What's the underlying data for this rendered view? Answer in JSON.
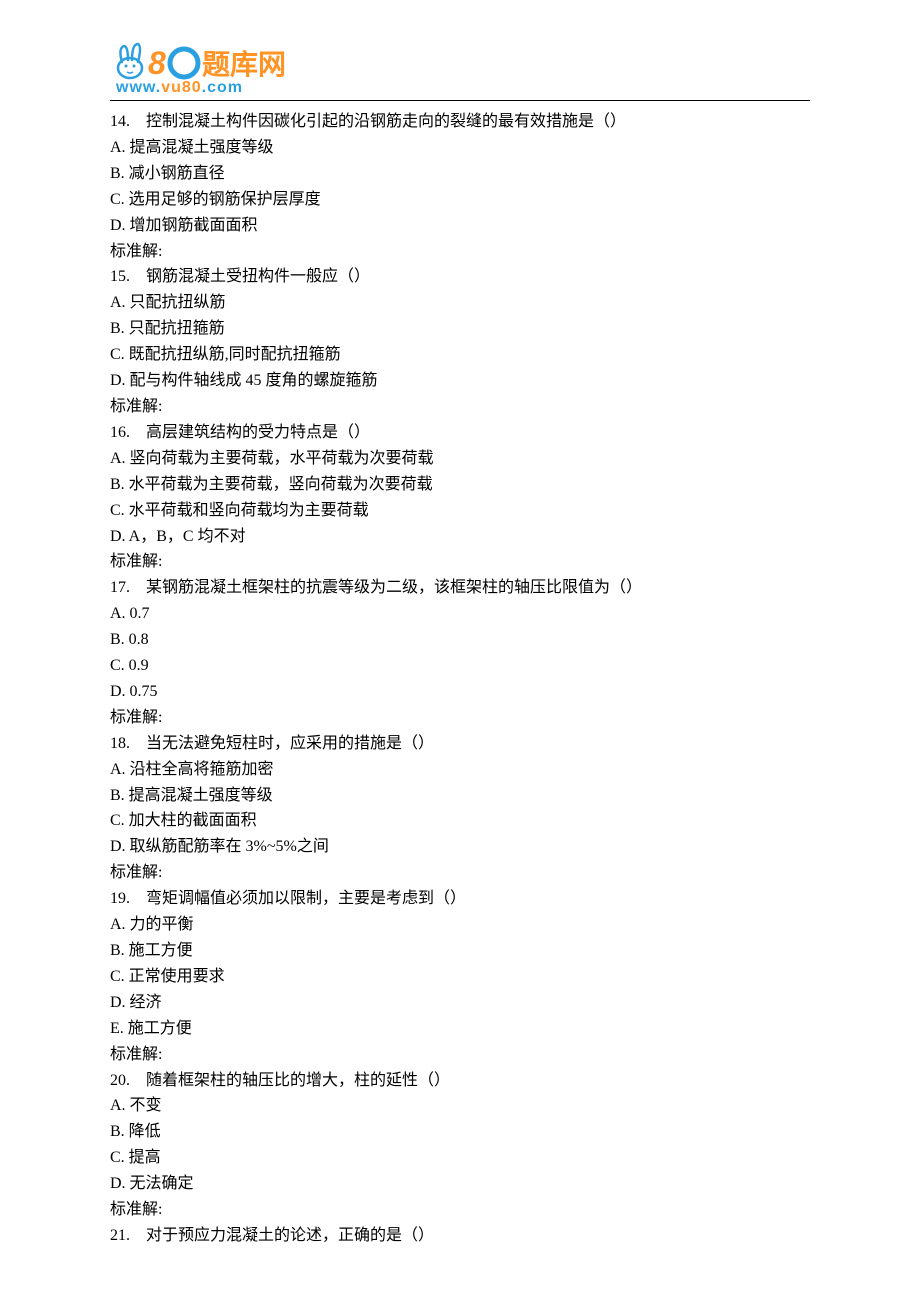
{
  "logo": {
    "main_text": "题库网",
    "prefix_text": "8",
    "circle_text": "O",
    "url": "www.vu80.com"
  },
  "questions": [
    {
      "num": "14.",
      "stem": "控制混凝土构件因碳化引起的沿钢筋走向的裂缝的最有效措施是（）",
      "options": [
        "A. 提高混凝土强度等级",
        "B. 减小钢筋直径",
        "C. 选用足够的钢筋保护层厚度",
        "D. 增加钢筋截面面积"
      ],
      "answer_label": "标准解:"
    },
    {
      "num": "15.",
      "stem": "钢筋混凝土受扭构件一般应（）",
      "options": [
        "A. 只配抗扭纵筋",
        "B. 只配抗扭箍筋",
        "C. 既配抗扭纵筋,同时配抗扭箍筋",
        "D. 配与构件轴线成 45 度角的螺旋箍筋"
      ],
      "answer_label": "标准解:"
    },
    {
      "num": "16.",
      "stem": "高层建筑结构的受力特点是（）",
      "options": [
        "A. 竖向荷载为主要荷载，水平荷载为次要荷载",
        "B. 水平荷载为主要荷载，竖向荷载为次要荷载",
        "C. 水平荷载和竖向荷载均为主要荷载",
        "D. A，B，C 均不对"
      ],
      "answer_label": "标准解:"
    },
    {
      "num": "17.",
      "stem": "某钢筋混凝土框架柱的抗震等级为二级，该框架柱的轴压比限值为（）",
      "options": [
        "A. 0.7",
        "B. 0.8",
        "C. 0.9",
        "D. 0.75"
      ],
      "answer_label": "标准解:"
    },
    {
      "num": "18.",
      "stem": "当无法避免短柱时，应采用的措施是（）",
      "options": [
        "A. 沿柱全高将箍筋加密",
        "B. 提高混凝土强度等级",
        "C. 加大柱的截面面积",
        "D. 取纵筋配筋率在 3%~5%之间"
      ],
      "answer_label": "标准解:"
    },
    {
      "num": "19.",
      "stem": "弯矩调幅值必须加以限制，主要是考虑到（）",
      "options": [
        "A. 力的平衡",
        "B. 施工方便",
        "C. 正常使用要求",
        "D. 经济",
        "E. 施工方便"
      ],
      "answer_label": "标准解:"
    },
    {
      "num": "20.",
      "stem": "随着框架柱的轴压比的增大，柱的延性（）",
      "options": [
        "A. 不变",
        "B. 降低",
        "C. 提高",
        "D. 无法确定"
      ],
      "answer_label": "标准解:"
    },
    {
      "num": "21.",
      "stem": "对于预应力混凝土的论述，正确的是（）",
      "options": [],
      "answer_label": ""
    }
  ]
}
